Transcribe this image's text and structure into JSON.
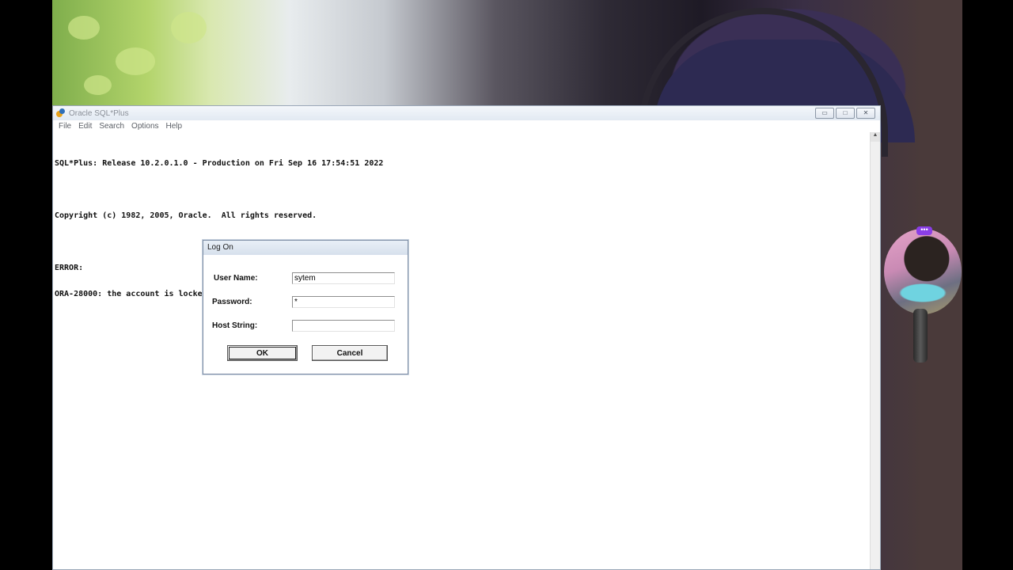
{
  "window": {
    "title": "Oracle SQL*Plus",
    "icon": "sqlplus-app-icon",
    "controls": {
      "minimize": "▭",
      "maximize": "□",
      "close": "✕"
    }
  },
  "menu": {
    "items": [
      "File",
      "Edit",
      "Search",
      "Options",
      "Help"
    ]
  },
  "console": {
    "lines": [
      "SQL*Plus: Release 10.2.0.1.0 - Production on Fri Sep 16 17:54:51 2022",
      "",
      "Copyright (c) 1982, 2005, Oracle.  All rights reserved.",
      "",
      "ERROR:",
      "ORA-28000: the account is locked"
    ]
  },
  "dialog": {
    "title": "Log On",
    "username_label": "User Name:",
    "username_value": "sytem",
    "password_label": "Password:",
    "password_value": "*",
    "host_label": "Host String:",
    "host_value": "",
    "ok_label": "OK",
    "cancel_label": "Cancel"
  },
  "overlay": {
    "cam_badge": "•••"
  }
}
